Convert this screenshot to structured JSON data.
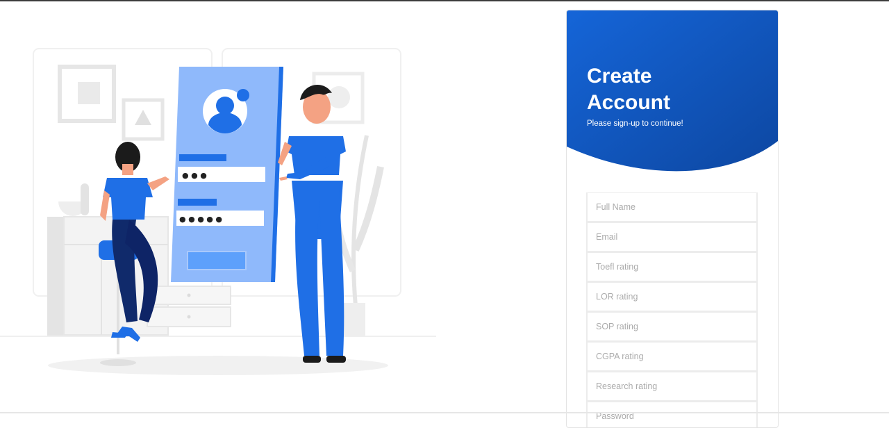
{
  "header": {
    "title_line1": "Create",
    "title_line2": "Account",
    "subtitle": "Please sign-up to continue!"
  },
  "form": {
    "fields": [
      {
        "placeholder": "Full Name",
        "value": ""
      },
      {
        "placeholder": "Email",
        "value": ""
      },
      {
        "placeholder": "Toefl rating",
        "value": ""
      },
      {
        "placeholder": "LOR rating",
        "value": ""
      },
      {
        "placeholder": "SOP rating",
        "value": ""
      },
      {
        "placeholder": "CGPA rating",
        "value": ""
      },
      {
        "placeholder": "Research rating",
        "value": ""
      },
      {
        "placeholder": "Password",
        "value": ""
      }
    ]
  },
  "illustration": {
    "icon": "signup-illustration-icon",
    "password_dots_1": "● ● ●",
    "password_dots_2": "● ● ● ● ●"
  },
  "colors": {
    "primary": "#1565d8",
    "primary_dark": "#0d47a1",
    "field_border": "#ececec",
    "placeholder": "#ababab"
  }
}
